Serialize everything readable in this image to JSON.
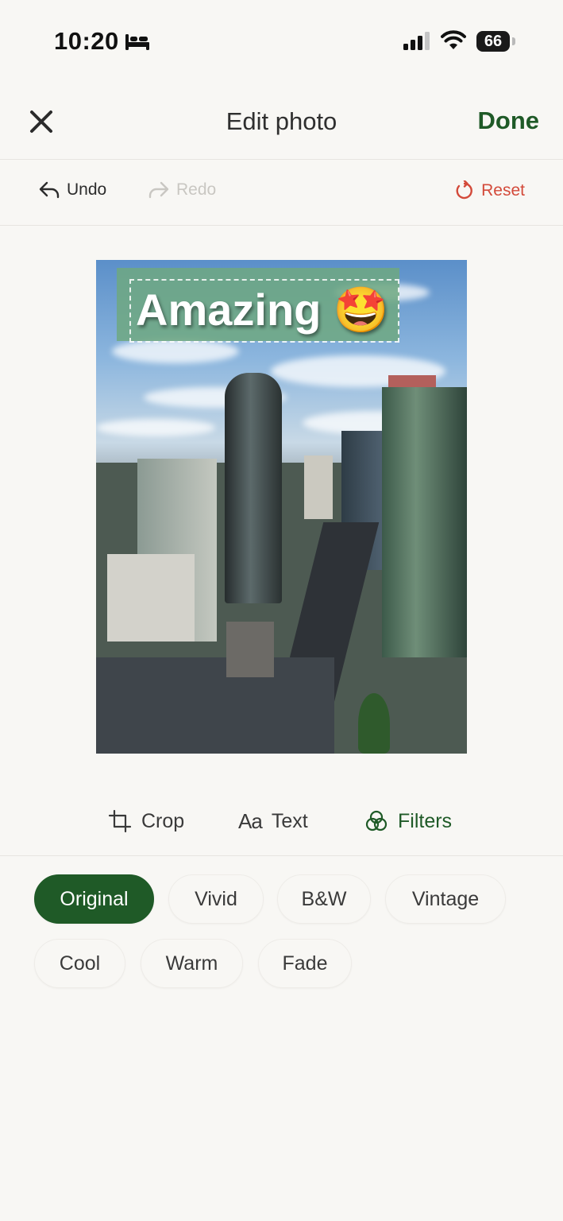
{
  "status": {
    "time": "10:20",
    "battery": "66"
  },
  "nav": {
    "title": "Edit photo",
    "done": "Done"
  },
  "history": {
    "undo": "Undo",
    "redo": "Redo",
    "reset": "Reset"
  },
  "photo": {
    "overlay_text": "Amazing 🤩"
  },
  "tools": {
    "crop": "Crop",
    "text_icon": "Aa",
    "text": "Text",
    "filters": "Filters"
  },
  "filters": {
    "selected": "Original",
    "options": [
      "Original",
      "Vivid",
      "B&W",
      "Vintage",
      "Cool",
      "Warm",
      "Fade"
    ]
  },
  "colors": {
    "accent": "#1f5a27",
    "reset": "#d34a3a",
    "background": "#f8f7f4"
  }
}
